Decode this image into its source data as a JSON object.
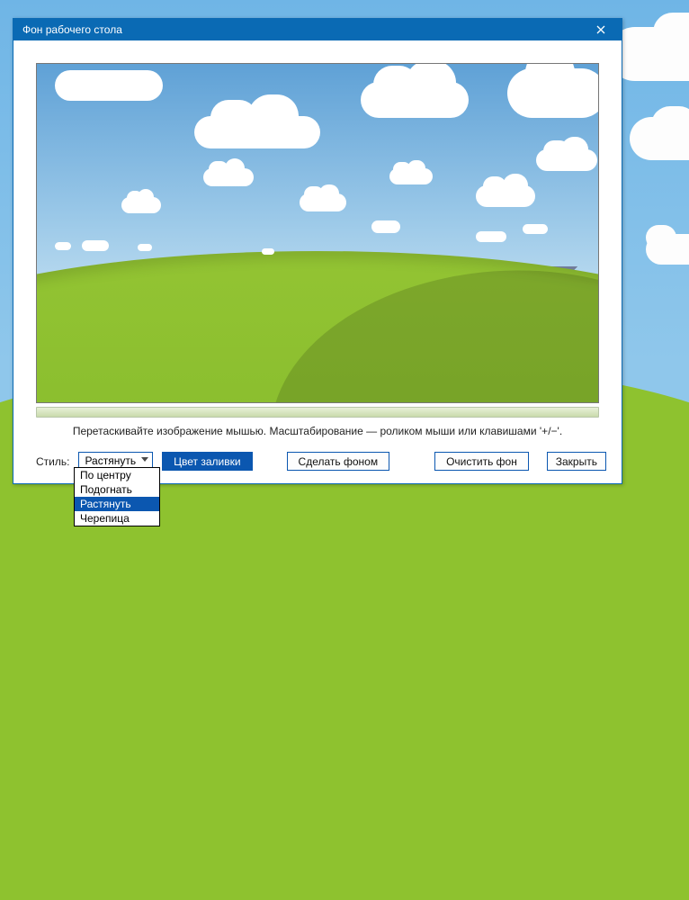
{
  "window": {
    "title": "Фон рабочего стола"
  },
  "hint": "Перетаскивайте изображение мышью. Масштабирование — роликом мыши или клавишами '+/−'.",
  "controls": {
    "style_label": "Стиль:",
    "style_value": "Растянуть",
    "fill_color": "Цвет заливки",
    "set_bg": "Сделать фоном",
    "clear_bg": "Очистить фон",
    "close": "Закрыть"
  },
  "style_dropdown": {
    "options": [
      "По центру",
      "Подогнать",
      "Растянуть",
      "Черепица"
    ],
    "selected_index": 2
  }
}
